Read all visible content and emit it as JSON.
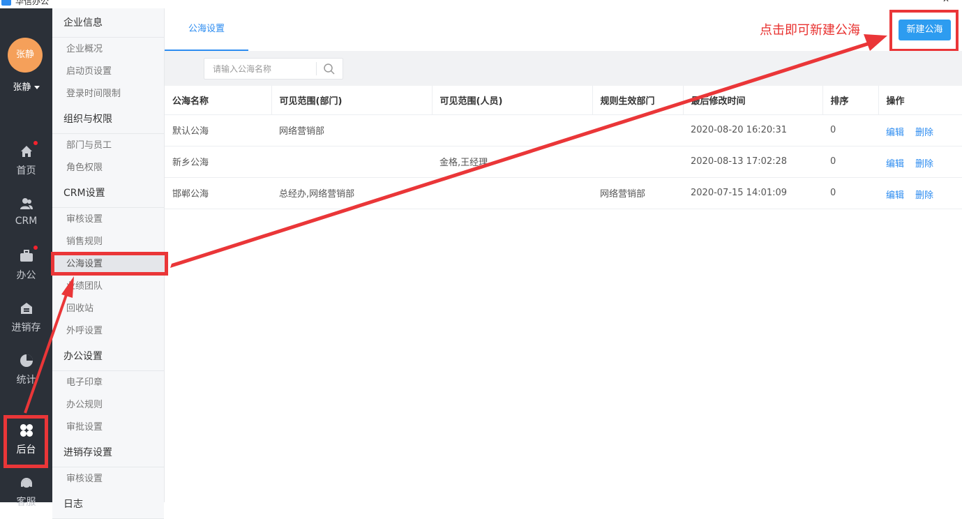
{
  "titlebar": {
    "app_name": "华信办公",
    "minimize": "—",
    "close": "✕"
  },
  "user": {
    "avatar_text": "张静",
    "name": "张静"
  },
  "rail": {
    "items": [
      {
        "label": "首页",
        "icon": "home-icon",
        "has_dot": true
      },
      {
        "label": "CRM",
        "icon": "users-icon",
        "has_dot": false
      },
      {
        "label": "办公",
        "icon": "briefcase-icon",
        "has_dot": true
      },
      {
        "label": "进销存",
        "icon": "warehouse-icon",
        "has_dot": false
      },
      {
        "label": "统计",
        "icon": "pie-chart-icon",
        "has_dot": false
      },
      {
        "label": "后台",
        "icon": "grid-icon",
        "has_dot": false
      },
      {
        "label": "客服",
        "icon": "headset-icon",
        "has_dot": false
      }
    ]
  },
  "submenu": {
    "groups": [
      {
        "title": "企业信息",
        "items": [
          "企业概况",
          "启动页设置",
          "登录时间限制"
        ]
      },
      {
        "title": "组织与权限",
        "items": [
          "部门与员工",
          "角色权限"
        ]
      },
      {
        "title": "CRM设置",
        "items": [
          "审核设置",
          "销售规则",
          "公海设置",
          "业绩团队",
          "回收站",
          "外呼设置"
        ]
      },
      {
        "title": "办公设置",
        "items": [
          "电子印章",
          "办公规则",
          "审批设置"
        ]
      },
      {
        "title": "进销存设置",
        "items": [
          "审核设置"
        ]
      },
      {
        "title": "日志",
        "items": []
      }
    ],
    "selected": "公海设置"
  },
  "main": {
    "tab_label": "公海设置",
    "annotation": "点击即可新建公海",
    "new_button": "新建公海",
    "search_placeholder": "请输入公海名称",
    "columns": [
      "公海名称",
      "可见范围(部门)",
      "可见范围(人员)",
      "规则生效部门",
      "最后修改时间",
      "排序",
      "操作"
    ],
    "rows": [
      {
        "name": "默认公海",
        "dept": "网络营销部",
        "people": "",
        "rule_dept": "",
        "modified": "2020-08-20 16:20:31",
        "order": "0",
        "edit": "编辑",
        "delete": "删除"
      },
      {
        "name": "新乡公海",
        "dept": "",
        "people": "金格,王经理",
        "rule_dept": "",
        "modified": "2020-08-13 17:02:28",
        "order": "0",
        "edit": "编辑",
        "delete": "删除"
      },
      {
        "name": "邯郸公海",
        "dept": "总经办,网络营销部",
        "people": "",
        "rule_dept": "网络营销部",
        "modified": "2020-07-15 14:01:09",
        "order": "0",
        "edit": "编辑",
        "delete": "删除"
      }
    ]
  },
  "colors": {
    "accent": "#2d8cf0",
    "annotation_red": "#ea3638",
    "rail_bg": "#2b3038",
    "avatar": "#f5a05a"
  }
}
